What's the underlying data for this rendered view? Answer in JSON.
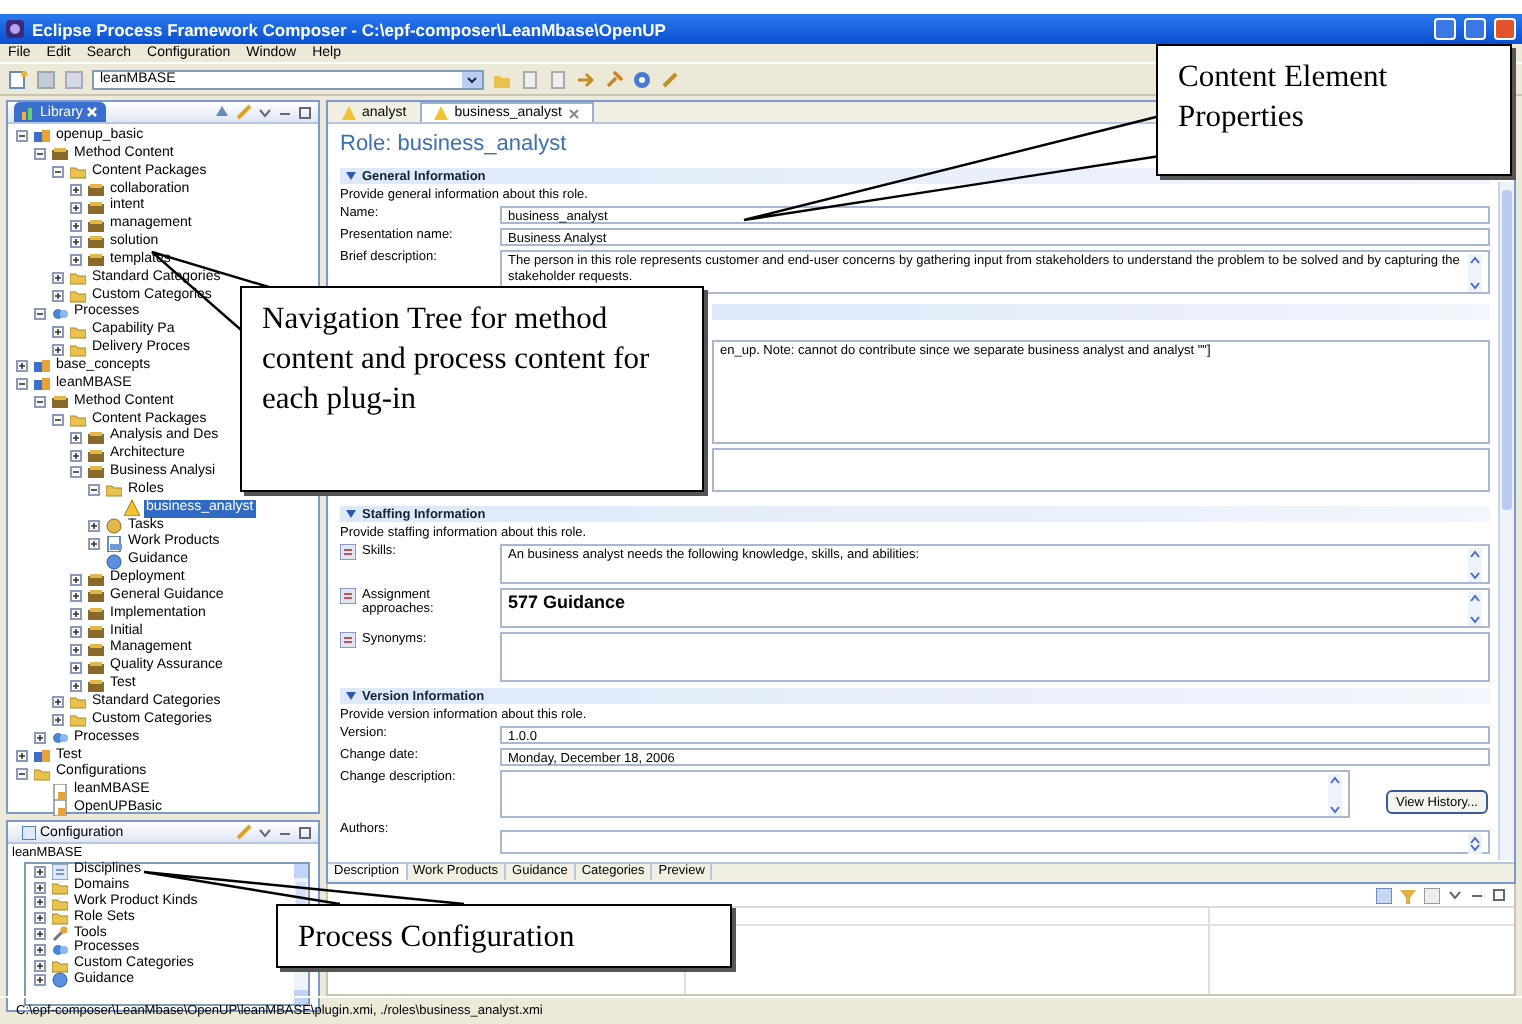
{
  "window": {
    "title": "Eclipse Process Framework Composer - C:\\epf-composer\\LeanMbase\\OpenUP"
  },
  "menu": [
    "File",
    "Edit",
    "Search",
    "Configuration",
    "Window",
    "Help"
  ],
  "toolbar": {
    "configuration": "leanMBASE"
  },
  "library": {
    "title": "Library",
    "tree": [
      {
        "label": "openup_basic",
        "kind": "plugin",
        "expanded": true,
        "selected": false,
        "children": [
          {
            "label": "Method Content",
            "kind": "package",
            "expanded": true,
            "selected": false,
            "children": [
              {
                "label": "Content Packages",
                "kind": "folder",
                "expanded": true,
                "selected": false,
                "children": [
                  {
                    "label": "collaboration",
                    "kind": "package",
                    "expanded": false,
                    "selected": false
                  },
                  {
                    "label": "intent",
                    "kind": "package",
                    "expanded": false,
                    "selected": false
                  },
                  {
                    "label": "management",
                    "kind": "package",
                    "expanded": false,
                    "selected": false
                  },
                  {
                    "label": "solution",
                    "kind": "package",
                    "expanded": false,
                    "selected": false
                  },
                  {
                    "label": "templates",
                    "kind": "package",
                    "expanded": false,
                    "selected": false
                  }
                ]
              },
              {
                "label": "Standard Categories",
                "kind": "folder",
                "expanded": false,
                "selected": false
              },
              {
                "label": "Custom Categories",
                "kind": "folder",
                "expanded": false,
                "selected": false
              }
            ]
          },
          {
            "label": "Processes",
            "kind": "process",
            "expanded": true,
            "selected": false,
            "children": [
              {
                "label": "Capability Pa",
                "kind": "folder",
                "expanded": false,
                "selected": false
              },
              {
                "label": "Delivery Proces",
                "kind": "folder",
                "expanded": false,
                "selected": false
              }
            ]
          }
        ]
      },
      {
        "label": "base_concepts",
        "kind": "plugin",
        "expanded": false,
        "selected": false
      },
      {
        "label": "leanMBASE",
        "kind": "plugin",
        "expanded": true,
        "selected": false,
        "children": [
          {
            "label": "Method Content",
            "kind": "package",
            "expanded": true,
            "selected": false,
            "children": [
              {
                "label": "Content Packages",
                "kind": "folder",
                "expanded": true,
                "selected": false,
                "children": [
                  {
                    "label": "Analysis and Des",
                    "kind": "package",
                    "expanded": false,
                    "selected": false
                  },
                  {
                    "label": "Architecture",
                    "kind": "package",
                    "expanded": false,
                    "selected": false
                  },
                  {
                    "label": "Business Analysi",
                    "kind": "package",
                    "expanded": true,
                    "selected": false,
                    "children": [
                      {
                        "label": "Roles",
                        "kind": "folder",
                        "expanded": true,
                        "selected": false,
                        "children": [
                          {
                            "label": "business_analyst",
                            "kind": "role",
                            "selected": true
                          }
                        ]
                      },
                      {
                        "label": "Tasks",
                        "kind": "task",
                        "expanded": false,
                        "selected": false
                      },
                      {
                        "label": "Work Products",
                        "kind": "workproduct",
                        "expanded": false,
                        "selected": false
                      },
                      {
                        "label": "Guidance",
                        "kind": "guidance",
                        "selected": false
                      }
                    ]
                  },
                  {
                    "label": "Deployment",
                    "kind": "package",
                    "expanded": false,
                    "selected": false
                  },
                  {
                    "label": "General Guidance",
                    "kind": "package",
                    "expanded": false,
                    "selected": false
                  },
                  {
                    "label": "Implementation",
                    "kind": "package",
                    "expanded": false,
                    "selected": false
                  },
                  {
                    "label": "Initial",
                    "kind": "package",
                    "expanded": false,
                    "selected": false
                  },
                  {
                    "label": "Management",
                    "kind": "package",
                    "expanded": false,
                    "selected": false
                  },
                  {
                    "label": "Quality Assurance",
                    "kind": "package",
                    "expanded": false,
                    "selected": false
                  },
                  {
                    "label": "Test",
                    "kind": "package",
                    "expanded": false,
                    "selected": false
                  }
                ]
              },
              {
                "label": "Standard Categories",
                "kind": "folder",
                "expanded": false,
                "selected": false
              },
              {
                "label": "Custom Categories",
                "kind": "folder",
                "expanded": false,
                "selected": false
              }
            ]
          },
          {
            "label": "Processes",
            "kind": "process",
            "expanded": false,
            "selected": false
          }
        ]
      },
      {
        "label": "Test",
        "kind": "plugin",
        "expanded": false,
        "selected": false
      },
      {
        "label": "Configurations",
        "kind": "folder",
        "expanded": true,
        "selected": false,
        "children": [
          {
            "label": "leanMBASE",
            "kind": "config",
            "selected": false
          },
          {
            "label": "OpenUPBasic",
            "kind": "config",
            "selected": false
          }
        ]
      }
    ]
  },
  "configuration_view": {
    "title": "Configuration",
    "name": "leanMBASE",
    "tree": [
      {
        "label": "Disciplines",
        "kind": "discipline",
        "expanded": false,
        "selected": false
      },
      {
        "label": "Domains",
        "kind": "folder",
        "expanded": false,
        "selected": false
      },
      {
        "label": "Work Product Kinds",
        "kind": "folder",
        "expanded": false,
        "selected": false
      },
      {
        "label": "Role Sets",
        "kind": "folder",
        "expanded": false,
        "selected": false
      },
      {
        "label": "Tools",
        "kind": "tool",
        "expanded": false,
        "selected": false
      },
      {
        "label": "Processes",
        "kind": "process",
        "expanded": false,
        "selected": false
      },
      {
        "label": "Custom Categories",
        "kind": "folder",
        "expanded": false,
        "selected": false
      },
      {
        "label": "Guidance",
        "kind": "guidance",
        "expanded": false,
        "selected": false
      }
    ]
  },
  "editor": {
    "tabs": [
      {
        "label": "analyst",
        "selected": false
      },
      {
        "label": "business_analyst",
        "selected": true
      }
    ],
    "heading": "Role: business_analyst",
    "sections": [
      {
        "kind": "titled",
        "title": "General Information",
        "description": "Provide general information about this role.",
        "fields": [
          {
            "kind": "line",
            "label": "Name:",
            "value": "business_analyst"
          },
          {
            "kind": "line",
            "label": "Presentation name:",
            "value": "Business Analyst"
          },
          {
            "kind": "area",
            "label": "Brief description:",
            "value": "The person in this role represents customer and end-user concerns by gathering input from stakeholders to understand the problem to be solved and by capturing the stakeholder requests."
          }
        ]
      },
      {
        "kind": "covered",
        "fields": [
          {
            "kind": "bigarea",
            "value": "en_up. Note: cannot do contribute since we separate business analyst and analyst \"\"]"
          },
          {
            "kind": "smallarea"
          }
        ]
      },
      {
        "kind": "titled",
        "title": "Staffing Information",
        "description": "Provide staffing information about this role.",
        "fields": [
          {
            "kind": "rich",
            "label": "Skills:",
            "value": "An business analyst needs the following knowledge, skills, and abilities:"
          },
          {
            "kind": "rich",
            "label": "Assignment approaches:",
            "value": "577 Guidance",
            "bold": true
          },
          {
            "kind": "plain",
            "label": "Synonyms:"
          }
        ]
      },
      {
        "kind": "titled",
        "title": "Version Information",
        "description": "Provide version information about this role.",
        "fields": [
          {
            "kind": "line",
            "label": "Version:",
            "value": "1.0.0"
          },
          {
            "kind": "line",
            "label": "Change date:",
            "value": "Monday, December 18, 2006"
          },
          {
            "kind": "history",
            "label": "Change description:",
            "button": "View History..."
          },
          {
            "kind": "cut",
            "label": "Authors:"
          }
        ]
      }
    ],
    "bottom_tabs": [
      {
        "label": "Description",
        "selected": true
      },
      {
        "label": "Work Products",
        "selected": false
      },
      {
        "label": "Guidance",
        "selected": false
      },
      {
        "label": "Categories",
        "selected": false
      },
      {
        "label": "Preview",
        "selected": false
      }
    ]
  },
  "status_bar": "C:\\epf-composer\\LeanMbase\\OpenUP\\leanMBASE\\plugin.xmi, ./roles\\business_analyst.xmi",
  "callouts": [
    {
      "text": "Content Element Properties"
    },
    {
      "text": "Navigation Tree for method content and process content for each plug-in"
    },
    {
      "text": "Process Configuration"
    }
  ]
}
